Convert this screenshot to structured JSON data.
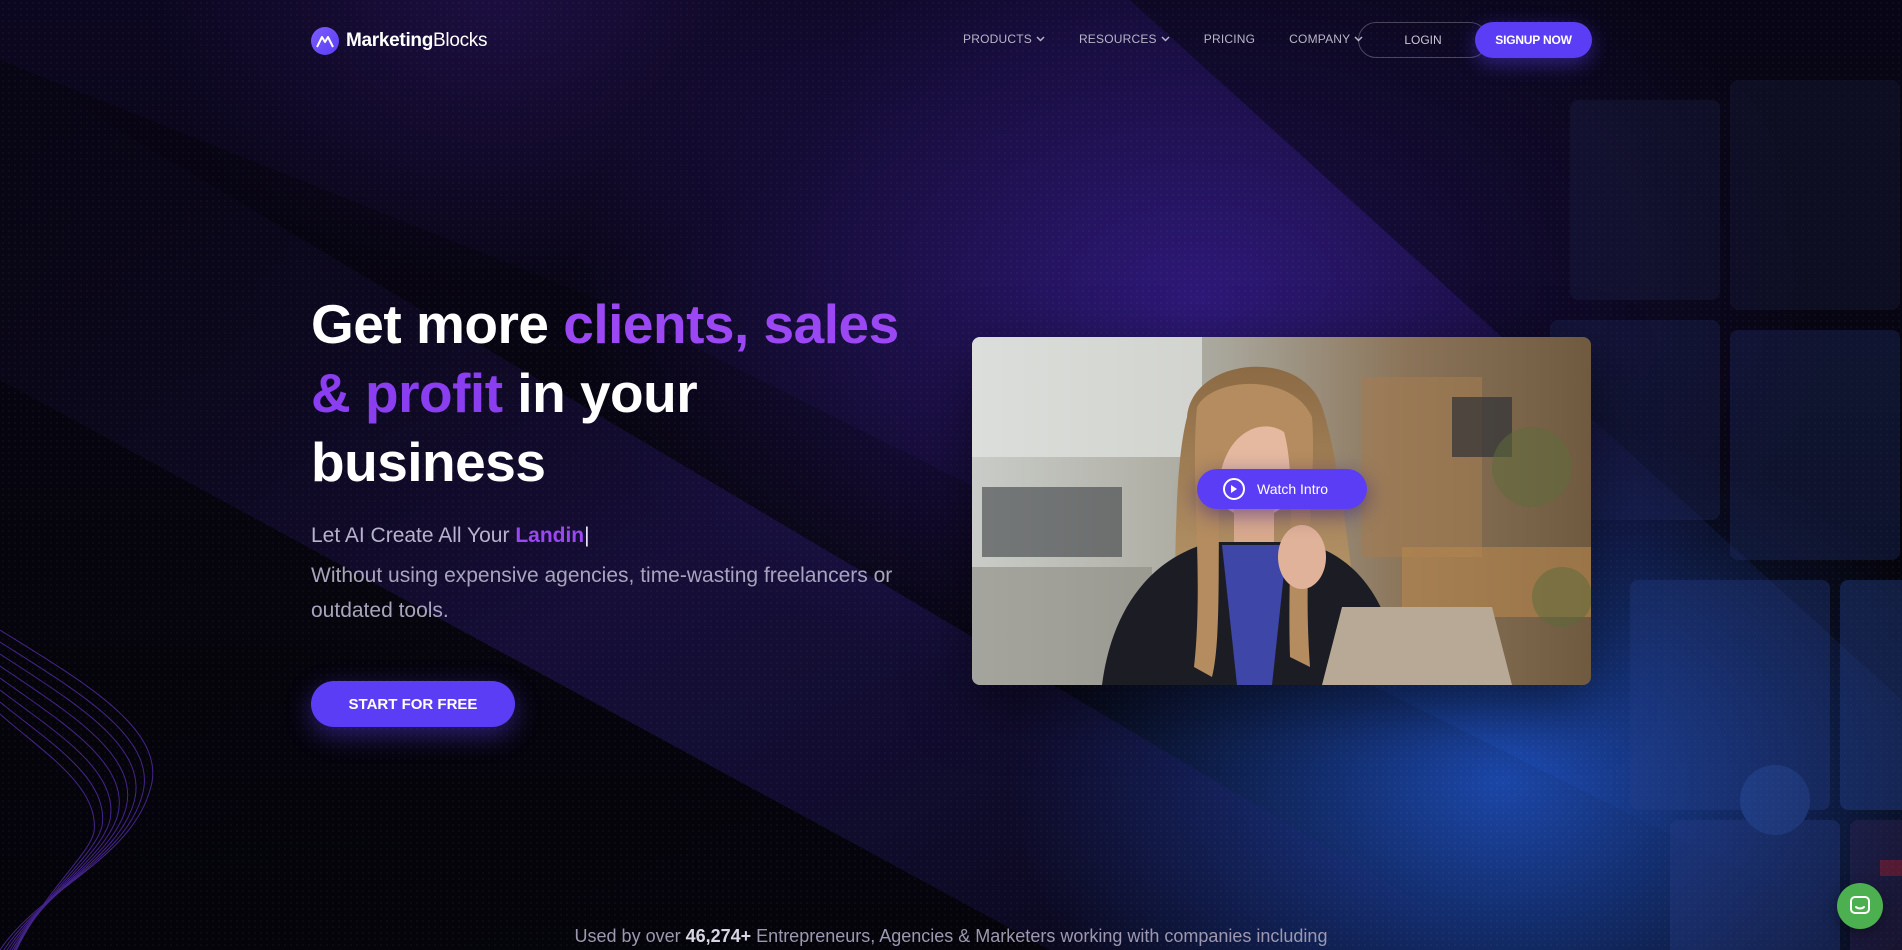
{
  "header": {
    "logo": {
      "bold": "Marketing",
      "regular": "Blocks"
    },
    "menu": [
      {
        "label": "PRODUCTS",
        "dropdown": true
      },
      {
        "label": "RESOURCES",
        "dropdown": true
      },
      {
        "label": "PRICING",
        "dropdown": false
      },
      {
        "label": "COMPANY",
        "dropdown": true
      }
    ],
    "login_label": "LOGIN",
    "signup_label": "SIGNUP NOW"
  },
  "hero": {
    "title_line1_white": "Get more ",
    "title_accent": "clients, sales",
    "title_accent2": "& profit",
    "title_line2_white": " in your",
    "title_line3": "business",
    "typed_prefix": "Let AI Create All Your ",
    "typed_word": "Landin",
    "caret": "|",
    "subline": "Without using expensive agencies, time-wasting freelancers or outdated tools.",
    "cta_label": "START FOR FREE"
  },
  "video": {
    "watch_label": "Watch Intro",
    "play_icon": "play-circle-icon"
  },
  "used_by": {
    "prefix": "Used by over ",
    "count": "46,274+",
    "suffix": " Entrepreneurs, Agencies & Marketers working with companies including"
  },
  "chat": {
    "icon": "chat-icon"
  },
  "colors": {
    "accent": "#5b3df5",
    "purple_text": "#9b48f4",
    "background": "#07050f",
    "glow_blue": "#2563eb",
    "chat_green": "#4caf50"
  }
}
